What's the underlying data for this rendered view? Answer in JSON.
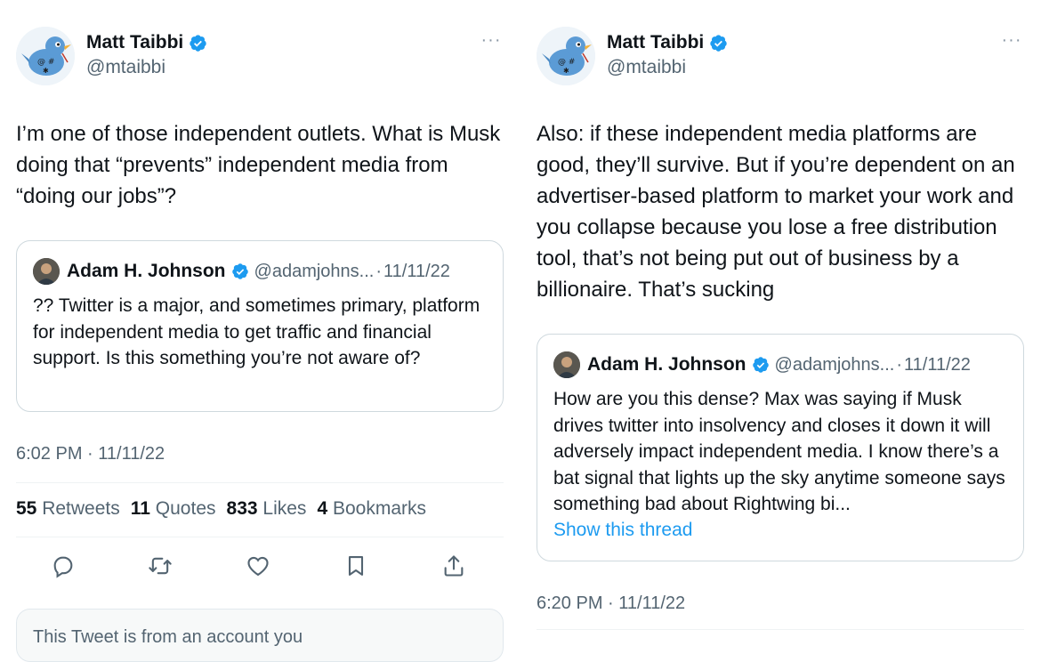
{
  "colors": {
    "verified": "#1d9bf0",
    "link": "#1d9bf0",
    "secondary_text": "#536471",
    "primary_text": "#0f1419",
    "border": "#cfd9de"
  },
  "left_tweet": {
    "author": {
      "name": "Matt Taibbi",
      "handle": "@mtaibbi",
      "avatar": "twitter-bird-avatar",
      "verified_icon": "verified-badge-icon"
    },
    "more_icon": "···",
    "text": "I’m one of those independent outlets. What is Musk doing that “prevents” independent media from “doing our jobs”?",
    "quote": {
      "name": "Adam H. Johnson",
      "handle": "@adamjohns...",
      "separator": "·",
      "date": "11/11/22",
      "text": "?? Twitter is a major, and sometimes primary, platform for independent media to get traffic and financial support. Is this something you’re not aware of?"
    },
    "timestamp": "6:02 PM · 11/11/22",
    "stats": [
      {
        "count": "55",
        "label": "Retweets"
      },
      {
        "count": "11",
        "label": "Quotes"
      },
      {
        "count": "833",
        "label": "Likes"
      },
      {
        "count": "4",
        "label": "Bookmarks"
      }
    ],
    "actions": [
      "reply-icon",
      "retweet-icon",
      "like-icon",
      "bookmark-icon",
      "share-icon"
    ],
    "notice": "This Tweet is from an account you"
  },
  "right_tweet": {
    "author": {
      "name": "Matt Taibbi",
      "handle": "@mtaibbi",
      "avatar": "twitter-bird-avatar",
      "verified_icon": "verified-badge-icon"
    },
    "more_icon": "···",
    "text": "Also: if these independent media platforms are good, they’ll survive. But if you’re dependent on an advertiser-based platform to market your work and you collapse because you lose a free distribution tool, that’s not being put out of business by a billionaire. That’s sucking",
    "quote": {
      "name": "Adam H. Johnson",
      "handle": "@adamjohns...",
      "separator": "·",
      "date": "11/11/22",
      "text": "How are you this dense? Max was saying if Musk drives twitter into insolvency and closes it down it will adversely impact independent media. I know there’s a bat signal that lights up the sky anytime someone says something bad about Rightwing bi...",
      "link": "Show this thread"
    },
    "timestamp": "6:20 PM · 11/11/22"
  }
}
